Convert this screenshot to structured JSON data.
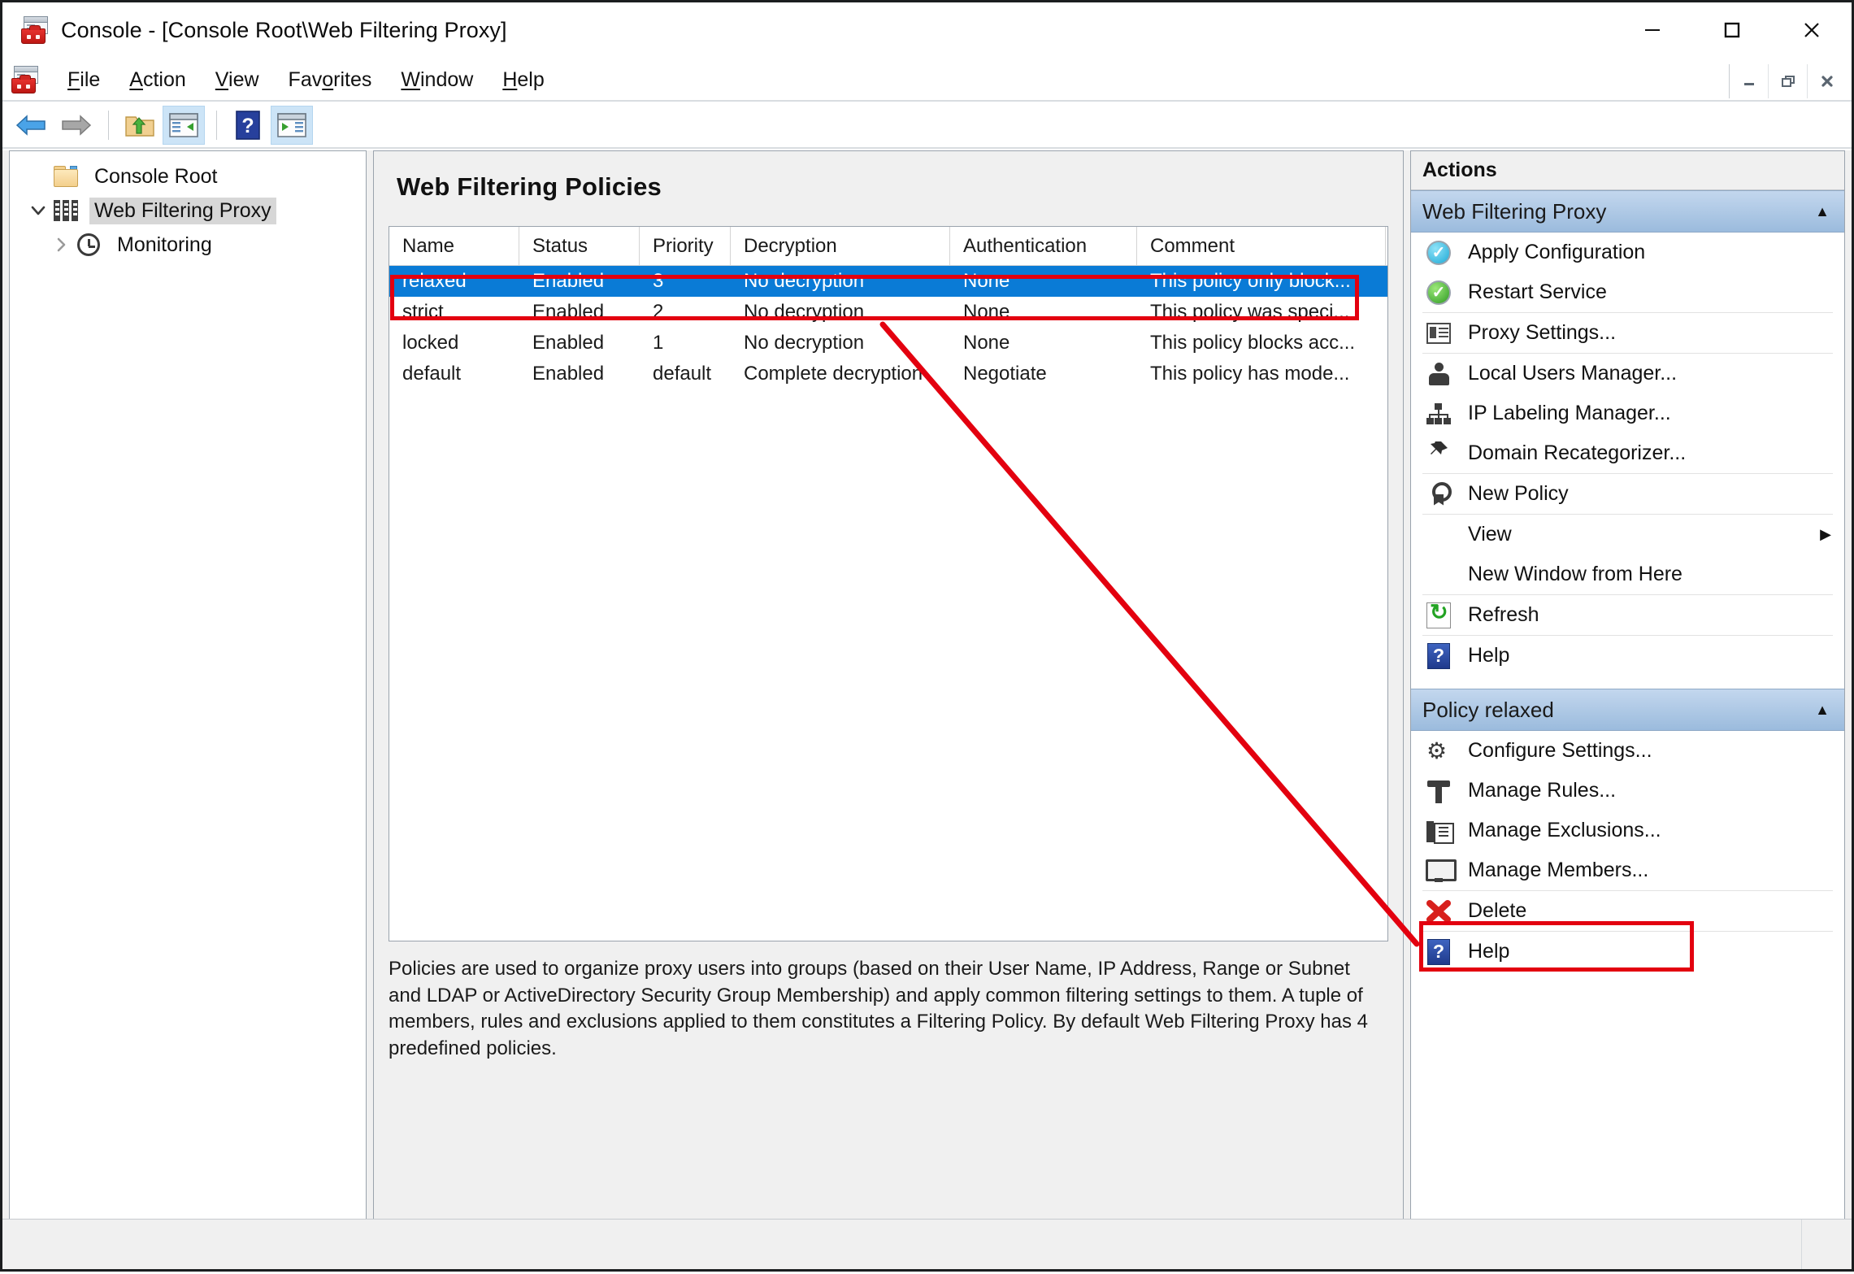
{
  "window": {
    "title": "Console - [Console Root\\Web Filtering Proxy]",
    "app_icon": "mmc-console-icon",
    "minimize": "minimize-icon",
    "maximize": "maximize-icon",
    "close": "close-icon"
  },
  "menubar": {
    "items": [
      {
        "label": "File",
        "accel": "F"
      },
      {
        "label": "Action",
        "accel": "A"
      },
      {
        "label": "View",
        "accel": "V"
      },
      {
        "label": "Favorites",
        "accel": "o"
      },
      {
        "label": "Window",
        "accel": "W"
      },
      {
        "label": "Help",
        "accel": "H"
      }
    ],
    "mdi": {
      "minimize": "mdi-minimize-icon",
      "restore": "mdi-restore-icon",
      "close": "mdi-close-icon"
    }
  },
  "toolbar": {
    "buttons": [
      {
        "name": "back-button",
        "icon": "back-arrow-icon",
        "selected": false
      },
      {
        "name": "forward-button",
        "icon": "forward-arrow-icon",
        "selected": false
      },
      {
        "name": "up-one-level-button",
        "icon": "folder-up-icon",
        "selected": false
      },
      {
        "name": "show-hide-console-tree-button",
        "icon": "console-tree-icon",
        "selected": true
      },
      {
        "name": "help-button",
        "icon": "help-icon",
        "selected": false
      },
      {
        "name": "show-hide-action-pane-button",
        "icon": "action-pane-icon",
        "selected": true
      }
    ]
  },
  "tree": {
    "nodes": [
      {
        "label": "Console Root",
        "icon": "folder-icon",
        "level": 0,
        "expanded": null,
        "selected": false
      },
      {
        "label": "Web Filtering Proxy",
        "icon": "proxy-bars-icon",
        "level": 1,
        "expanded": true,
        "selected": true
      },
      {
        "label": "Monitoring",
        "icon": "clock-icon",
        "level": 2,
        "expanded": false,
        "selected": false
      }
    ]
  },
  "main": {
    "title": "Web Filtering Policies",
    "columns": [
      "Name",
      "Status",
      "Priority",
      "Decryption",
      "Authentication",
      "Comment"
    ],
    "rows": [
      {
        "cells": [
          "relaxed",
          "Enabled",
          "3",
          "No decryption",
          "None",
          "This policy only block..."
        ],
        "selected": true
      },
      {
        "cells": [
          "strict",
          "Enabled",
          "2",
          "No decryption",
          "None",
          "This policy was speci..."
        ],
        "selected": false
      },
      {
        "cells": [
          "locked",
          "Enabled",
          "1",
          "No decryption",
          "None",
          "This policy blocks acc..."
        ],
        "selected": false
      },
      {
        "cells": [
          "default",
          "Enabled",
          "default",
          "Complete decryption",
          "Negotiate",
          "This policy has mode..."
        ],
        "selected": false
      }
    ],
    "description": "Policies are used to organize proxy users into groups (based on their User Name, IP Address, Range or Subnet and LDAP or ActiveDirectory Security Group Membership) and apply common filtering settings to them. A tuple of members, rules and exclusions applied to them constitutes a Filtering Policy. By default Web Filtering Proxy has 4 predefined policies."
  },
  "actions": {
    "caption": "Actions",
    "groups": [
      {
        "title": "Web Filtering Proxy",
        "collapse_glyph": "▲",
        "items": [
          {
            "label": "Apply Configuration",
            "icon": "apply-configuration-icon",
            "sep_after": false,
            "submenu": false
          },
          {
            "label": "Restart Service",
            "icon": "restart-service-icon",
            "sep_after": true,
            "submenu": false
          },
          {
            "label": "Proxy Settings...",
            "icon": "proxy-settings-icon",
            "sep_after": true,
            "submenu": false
          },
          {
            "label": "Local Users Manager...",
            "icon": "local-users-manager-icon",
            "sep_after": false,
            "submenu": false
          },
          {
            "label": "IP Labeling Manager...",
            "icon": "ip-labeling-manager-icon",
            "sep_after": false,
            "submenu": false
          },
          {
            "label": "Domain Recategorizer...",
            "icon": "domain-recategorizer-icon",
            "sep_after": true,
            "submenu": false
          },
          {
            "label": "New Policy",
            "icon": "new-policy-icon",
            "sep_after": true,
            "submenu": false
          },
          {
            "label": "View",
            "icon": "",
            "sep_after": false,
            "submenu": true,
            "submenu_glyph": "▶"
          },
          {
            "label": "New Window from Here",
            "icon": "",
            "sep_after": true,
            "submenu": false
          },
          {
            "label": "Refresh",
            "icon": "refresh-icon",
            "sep_after": true,
            "submenu": false
          },
          {
            "label": "Help",
            "icon": "help-icon",
            "sep_after": false,
            "submenu": false
          }
        ]
      },
      {
        "title": "Policy relaxed",
        "collapse_glyph": "▲",
        "items": [
          {
            "label": "Configure Settings...",
            "icon": "configure-settings-gear-icon",
            "sep_after": false,
            "submenu": false
          },
          {
            "label": "Manage Rules...",
            "icon": "manage-rules-hammer-icon",
            "sep_after": false,
            "submenu": false
          },
          {
            "label": "Manage Exclusions...",
            "icon": "manage-exclusions-icon",
            "sep_after": false,
            "submenu": false
          },
          {
            "label": "Manage Members...",
            "icon": "manage-members-monitor-icon",
            "sep_after": true,
            "submenu": false,
            "highlighted": true
          },
          {
            "label": "Delete",
            "icon": "delete-x-icon",
            "sep_after": true,
            "submenu": false
          },
          {
            "label": "Help",
            "icon": "help-icon",
            "sep_after": false,
            "submenu": false
          }
        ]
      }
    ]
  },
  "annotations": {
    "accent_color": "#e3000f",
    "selected_row_color": "#0a7bd6",
    "highlight_box_row": "relaxed",
    "highlight_box_action": "Manage Members...",
    "arrow_from": "relaxed row",
    "arrow_to": "Manage Members... action"
  },
  "statusbar": {
    "text": ""
  }
}
